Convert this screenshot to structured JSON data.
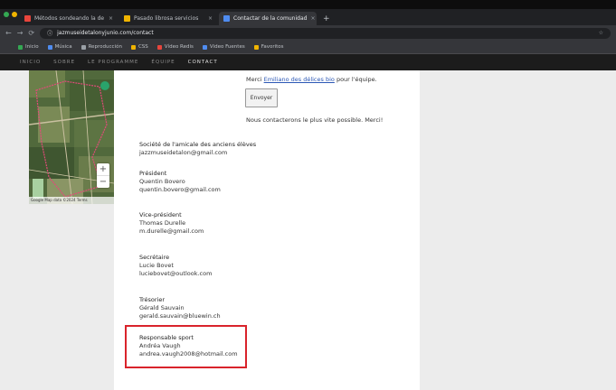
{
  "browser": {
    "tabs": [
      {
        "label": "Métodos sondeando la de",
        "active": false,
        "favicon_color": "#e8453c"
      },
      {
        "label": "Pasado librosa servicios",
        "active": false,
        "favicon_color": "#f0b400"
      },
      {
        "label": "Contactar de la comunidad",
        "active": true,
        "favicon_color": "#4f8cf0"
      }
    ],
    "new_tab_glyph": "+",
    "address": "jazmuseidetalonyjunio.com/contact",
    "bookmarks": [
      {
        "label": "Inicio",
        "color": "#34a853"
      },
      {
        "label": "Música",
        "color": "#4f8cf0"
      },
      {
        "label": "Reproducción",
        "color": "#9aa0a6"
      },
      {
        "label": "CSS",
        "color": "#f0b400"
      },
      {
        "label": "Vídeo Redis",
        "color": "#e8453c"
      },
      {
        "label": "Video Fuentes",
        "color": "#4f8cf0"
      },
      {
        "label": "Favoritos",
        "color": "#f0b400"
      }
    ]
  },
  "site_nav": {
    "items": [
      "INICIO",
      "SOBRE",
      "LE PROGRAMME",
      "ÉQUIPE",
      "CONTACT"
    ],
    "current_index": 4
  },
  "map": {
    "zoom_in": "+",
    "zoom_out": "−",
    "attribution": "Google  Map data ©2024  Terms"
  },
  "main": {
    "credit_prefix": "Merci",
    "credit_link": "Emiliano des délices bio",
    "credit_suffix": "pour l'équipe.",
    "button_label": "Envoyer",
    "note": "Nous contacterons le plus vite possible. Merci!",
    "org": {
      "name": "Société de l'amicale des anciens élèves",
      "email": "jazzmuseidetalon@gmail.com"
    },
    "contacts": [
      {
        "role": "Président",
        "name": "Quentin Bovero",
        "email": "quentin.bovero@gmail.com"
      },
      {
        "role": "Vice-président",
        "name": "Thomas Durelle",
        "email": "m.durelle@gmail.com"
      },
      {
        "role": "Secrétaire",
        "name": "Lucie Bovet",
        "email": "luciebovet@outlook.com"
      },
      {
        "role": "Trésorier",
        "name": "Gérald Sauvain",
        "email": "gerald.sauvain@bluewin.ch"
      },
      {
        "role": "Responsable sport",
        "name": "Andréa Vaugh",
        "email": "andrea.vaugh2008@hotmail.com"
      }
    ]
  },
  "colors": {
    "highlight_box": "#d9232b",
    "link": "#2b57b5"
  }
}
